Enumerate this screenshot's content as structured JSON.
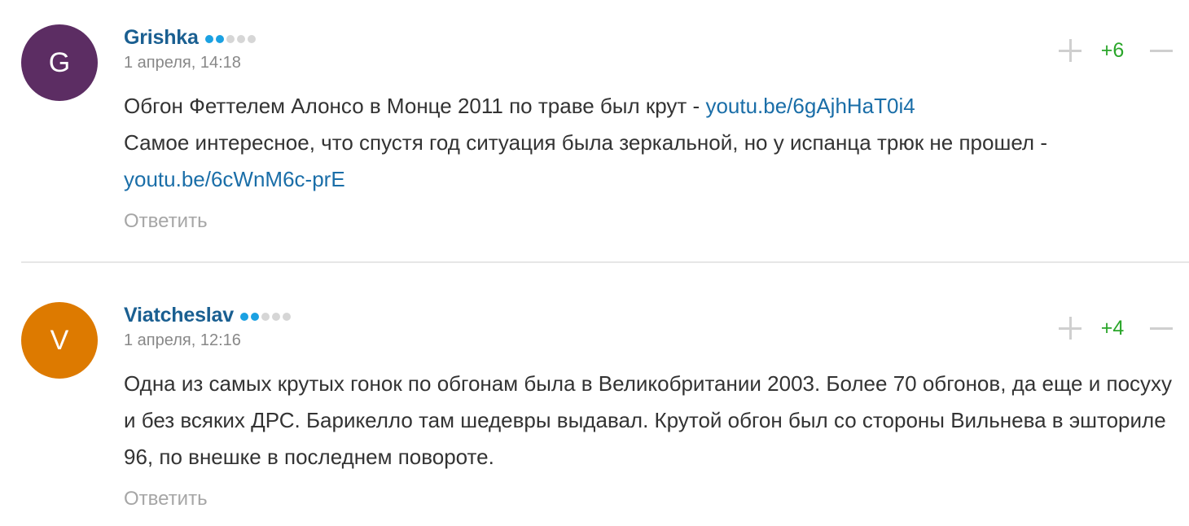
{
  "comments": [
    {
      "author": "Grishka",
      "avatar_letter": "G",
      "avatar_color": "#5c2d63",
      "rank_active": 2,
      "rank_total": 5,
      "date": "1 апреля, 14:18",
      "score": "+6",
      "reply_label": "Ответить",
      "line1_text": "Обгон Феттелем Алонсо в Монце 2011 по траве был крут - ",
      "line1_link": "youtu.be/6gAjhHaT0i4",
      "line2_text": "Самое интересное, что спустя год ситуация была зеркальной, но у испанца трюк не прошел - ",
      "line2_link": "youtu.be/6cWnM6c-prE"
    },
    {
      "author": "Viatcheslav",
      "avatar_letter": "V",
      "avatar_color": "#dd7a00",
      "rank_active": 2,
      "rank_total": 5,
      "date": "1 апреля, 12:16",
      "score": "+4",
      "reply_label": "Ответить",
      "text": "Одна из самых крутых гонок по обгонам была в Великобритании 2003. Более 70 обгонов, да еще и посуху и без всяких ДРС. Барикелло там шедевры выдавал. Крутой обгон был со стороны Вильнева в эшториле 96, по внешке в последнем повороте."
    }
  ],
  "colors": {
    "author": "#1a5f91",
    "link": "#1a6ea8",
    "score_positive": "#2aa62a",
    "rank_active": "#1ba1e2",
    "rank_inactive": "#d6d6d6"
  },
  "icons": [
    "plus-icon",
    "minus-icon"
  ]
}
